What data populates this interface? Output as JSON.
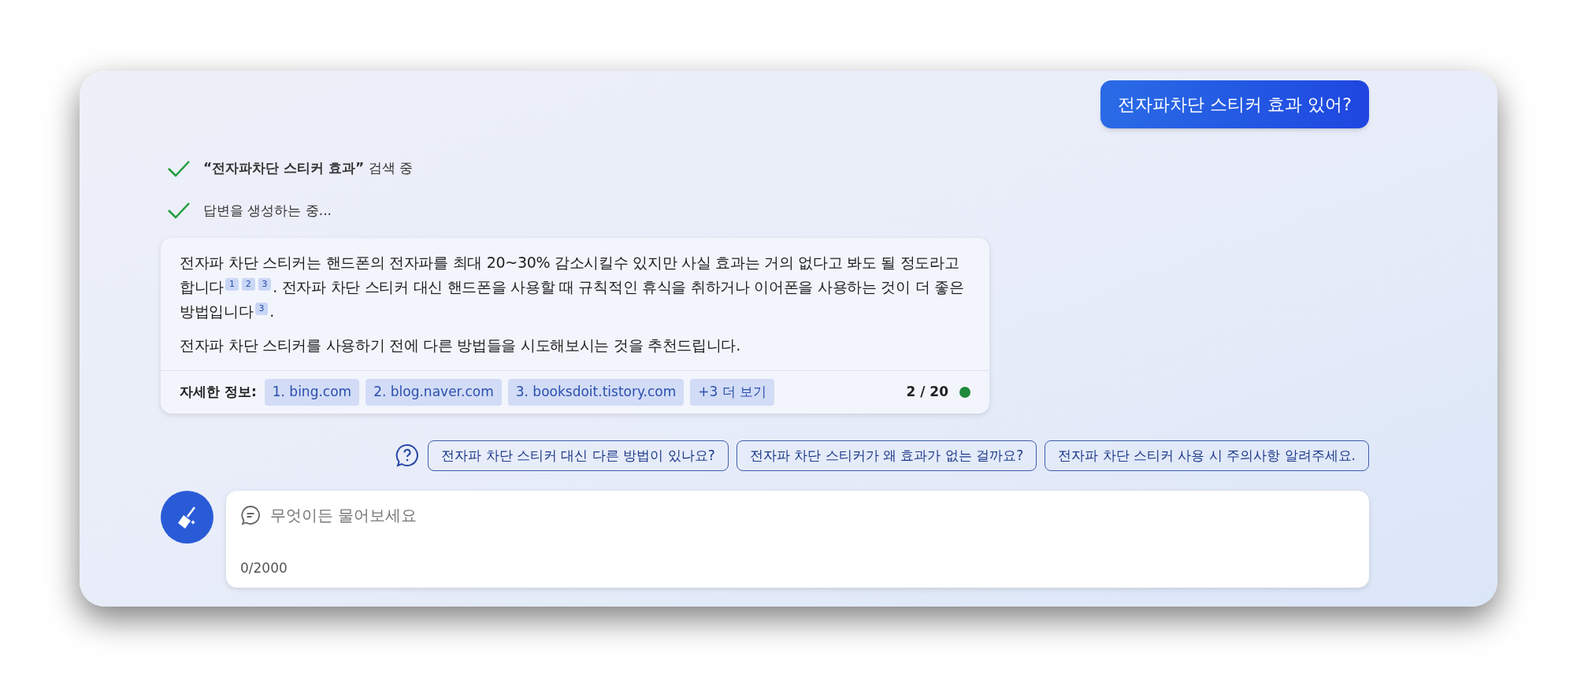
{
  "user_message": {
    "text": "전자파차단 스티커 효과 있어?"
  },
  "progress": [
    {
      "text": "**“전자파차단 스티커 효과”** 검색 중",
      "done": true
    },
    {
      "text": "답변을 생성하는 중...",
      "done": true
    }
  ],
  "answer": {
    "paragraphs": [
      {
        "parts": [
          {
            "kind": "text",
            "text": "전자파 차단 스티커는 핸드폰의 전자파를 최대 20~30% 감소시킬수 있지만 사실 효과는 거의 없다고 봐도 될 정도라고 합니다"
          },
          {
            "kind": "cite",
            "text": "1"
          },
          {
            "kind": "cite",
            "text": "2"
          },
          {
            "kind": "cite",
            "text": "3"
          },
          {
            "kind": "text",
            "text": ". 전자파 차단 스티커 대신 핸드폰을 사용할 때 규칙적인 휴식을 취하거나 이어폰을 사용하는 것이 더 좋은 방법입니다"
          },
          {
            "kind": "cite",
            "text": "3"
          },
          {
            "kind": "text",
            "text": "."
          }
        ]
      },
      {
        "parts": [
          {
            "kind": "text",
            "text": "전자파 차단 스티커를 사용하기 전에 다른 방법들을 시도해보시는 것을 추천드립니다."
          }
        ]
      }
    ],
    "sources_label": "자세한 정보:",
    "sources": [
      "1. bing.com",
      "2. blog.naver.com",
      "3. booksdoit.tistory.com",
      "+3 더 보기"
    ],
    "turn_count": "2 / 20"
  },
  "suggestions": [
    "전자파 차단 스티커 대신 다른 방법이 있나요?",
    "전자파 차단 스티커가 왜 효과가 없는 걸까요?",
    "전자파 차단 스티커 사용 시 주의사항 알려주세요."
  ],
  "input": {
    "placeholder": "무엇이든 물어보세요",
    "counter": "0/2000"
  }
}
